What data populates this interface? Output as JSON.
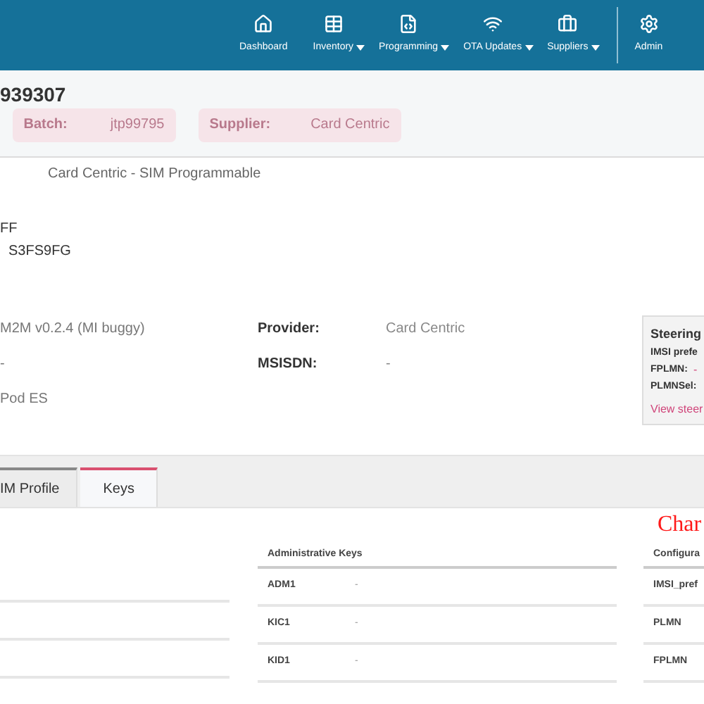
{
  "nav": [
    {
      "label": "Dashboard",
      "dropdown": false
    },
    {
      "label": "Inventory",
      "dropdown": true
    },
    {
      "label": "Programming",
      "dropdown": true
    },
    {
      "label": "OTA Updates",
      "dropdown": true
    },
    {
      "label": "Suppliers",
      "dropdown": true
    },
    {
      "label": "Admin",
      "dropdown": false
    }
  ],
  "header": {
    "title": "939307",
    "batch": {
      "label": "Batch:",
      "value": "jtp99795"
    },
    "supplier": {
      "label": "Supplier:",
      "value": "Card Centric"
    }
  },
  "details": {
    "description": "Card Centric - SIM Programmable",
    "line_1": "FF",
    "line_2": "S3FS9FG",
    "rows": [
      {
        "value": "M2M v0.2.4 (MI buggy)",
        "label": "Provider:",
        "label_value": "Card Centric"
      },
      {
        "value": "-",
        "label": "MSISDN:",
        "label_value": "-"
      },
      {
        "value": "Pod ES"
      }
    ]
  },
  "steering": {
    "title": "Steering",
    "lines": [
      {
        "label": "IMSI prefe"
      },
      {
        "label": "FPLMN:",
        "value": "-"
      },
      {
        "label": "PLMNSel:"
      }
    ],
    "link": "View steer"
  },
  "tabs": [
    {
      "label": "IM Profile",
      "selected": false
    },
    {
      "label": "Keys",
      "selected": true
    }
  ],
  "overlay_text": "Char",
  "admin_keys": {
    "title": "Administrative Keys",
    "rows": [
      {
        "key": "ADM1",
        "value": "-"
      },
      {
        "key": "KIC1",
        "value": "-"
      },
      {
        "key": "KID1",
        "value": "-"
      }
    ]
  },
  "configuration": {
    "title": "Configura",
    "rows": [
      "IMSI_pref",
      "PLMN",
      "FPLMN"
    ]
  }
}
